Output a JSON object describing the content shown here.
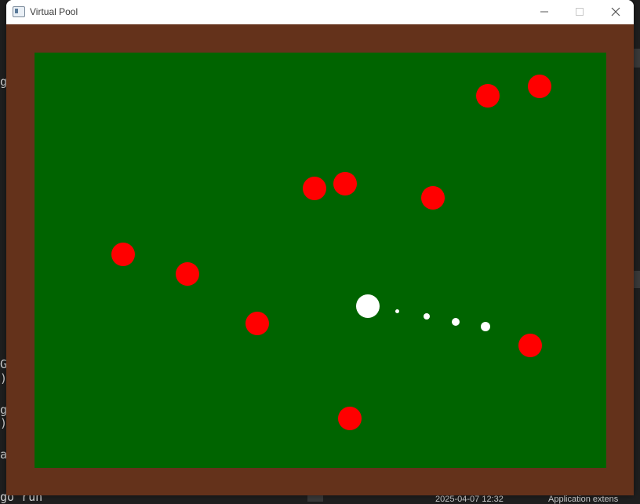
{
  "window": {
    "title": "Virtual Pool"
  },
  "colors": {
    "rail": "#64321b",
    "felt": "#006400",
    "object_ball": "#ff0000",
    "cue_ball": "#ffffff"
  },
  "background": {
    "terminal_fragments": [
      "g",
      "G",
      ")",
      "g",
      ")",
      "a",
      "go run"
    ],
    "taskbar_timestamp": "2025-04-07 12:32",
    "taskbar_label": "Application extens"
  }
}
